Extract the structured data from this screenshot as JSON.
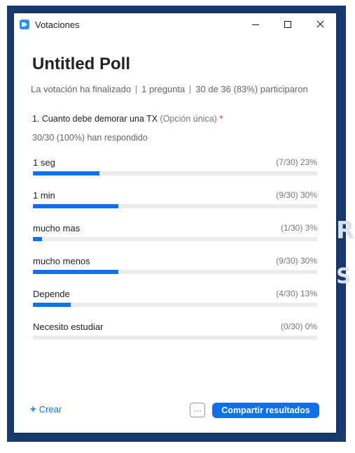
{
  "window": {
    "title": "Votaciones",
    "icons": {
      "app": "zoom-app-icon",
      "minimize": "minimize-icon",
      "maximize": "maximize-icon",
      "close": "close-icon"
    }
  },
  "poll": {
    "title": "Untitled Poll",
    "status": "La votación ha finalizado",
    "question_count": "1 pregunta",
    "participation": "30 de 36 (83%) participaron"
  },
  "question": {
    "text": "1. Cuanto debe demorar una TX",
    "type": "(Opción única)",
    "required_mark": "*",
    "responded": "30/30 (100%) han respondido"
  },
  "options": [
    {
      "label": "1 seg",
      "stat": "(7/30) 23%",
      "fraction": 0.233
    },
    {
      "label": "1 min",
      "stat": "(9/30) 30%",
      "fraction": 0.3
    },
    {
      "label": "mucho mas",
      "stat": "(1/30) 3%",
      "fraction": 0.033
    },
    {
      "label": "mucho menos",
      "stat": "(9/30) 30%",
      "fraction": 0.3
    },
    {
      "label": "Depende",
      "stat": "(4/30) 13%",
      "fraction": 0.133
    },
    {
      "label": "Necesito estudiar",
      "stat": "(0/30) 0%",
      "fraction": 0.0
    }
  ],
  "footer": {
    "create_label": "Crear",
    "plus_glyph": "+",
    "more_glyph": "···",
    "share_label": "Compartir resultados"
  },
  "colors": {
    "accent": "#0e71eb",
    "track": "#ebebf0",
    "backdrop": "#17396b",
    "required": "#e02828"
  }
}
